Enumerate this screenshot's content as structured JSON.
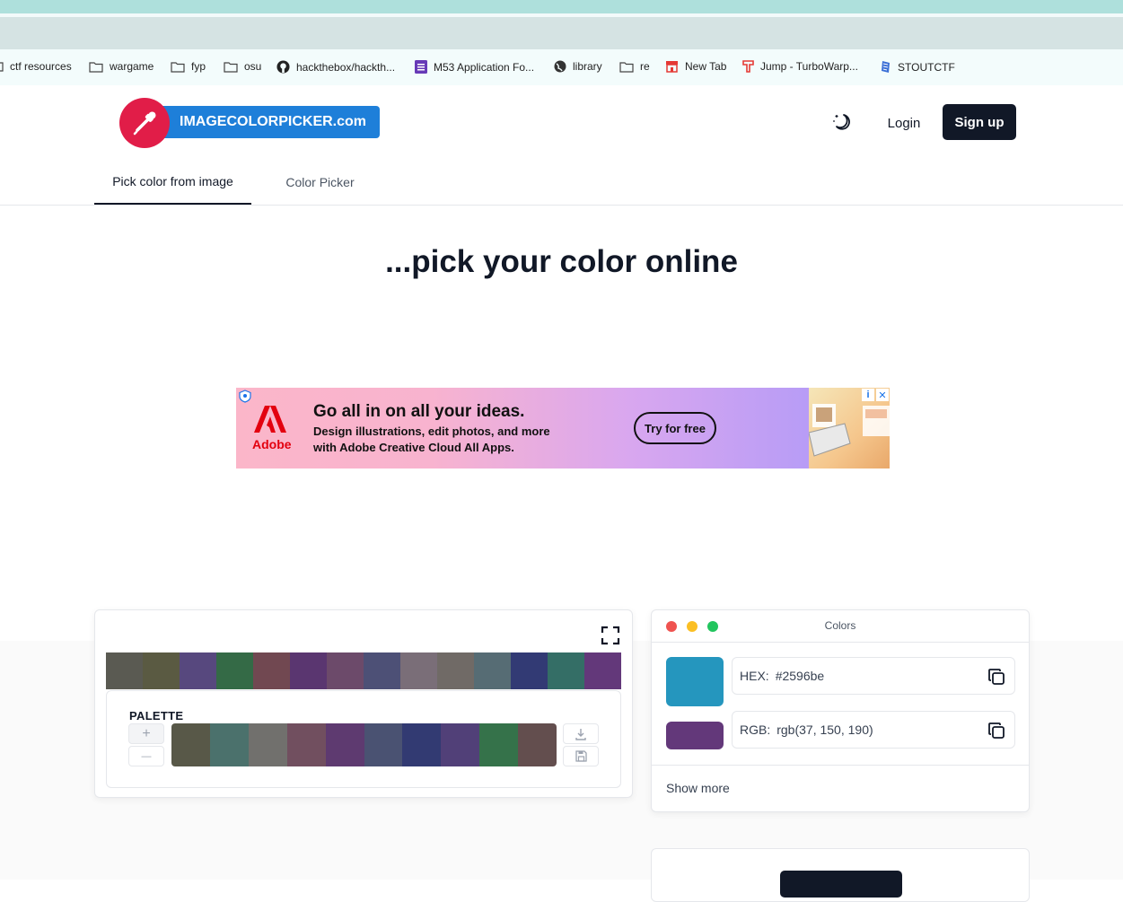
{
  "bookmarks": [
    {
      "label": "ctf resources",
      "icon": "folder-icon"
    },
    {
      "label": "wargame",
      "icon": "folder-icon"
    },
    {
      "label": "fyp",
      "icon": "folder-icon"
    },
    {
      "label": "osu",
      "icon": "folder-icon"
    },
    {
      "label": "hackthebox/hackth...",
      "icon": "github-icon"
    },
    {
      "label": "M53 Application Fo...",
      "icon": "forms-icon"
    },
    {
      "label": "library",
      "icon": "globe-icon"
    },
    {
      "label": "re",
      "icon": "folder-icon"
    },
    {
      "label": "New Tab",
      "icon": "store-icon"
    },
    {
      "label": "Jump - TurboWarp...",
      "icon": "turbowarp-icon"
    },
    {
      "label": "STOUTCTF",
      "icon": "flag-icon"
    }
  ],
  "header": {
    "logo_text": "IMAGECOLORPICKER.com",
    "login_label": "Login",
    "signup_label": "Sign up",
    "theme_icon": "moon-stars-icon"
  },
  "tabs": [
    {
      "label": "Pick color from image",
      "active": true
    },
    {
      "label": "Color Picker",
      "active": false
    }
  ],
  "headline": "...pick your color online",
  "ad": {
    "brand": "Adobe",
    "headline": "Go all in on all your ideas.",
    "line1": "Design illustrations, edit photos, and more",
    "line2": "with Adobe Creative Cloud All Apps.",
    "cta": "Try for free"
  },
  "image_strip_colors": [
    "#5a5a52",
    "#5a5a42",
    "#57487e",
    "#346a46",
    "#714851",
    "#5a3670",
    "#6c4a6a",
    "#4d5076",
    "#7a6e78",
    "#706a66",
    "#566c74",
    "#323a74",
    "#346e66",
    "#63387a"
  ],
  "palette": {
    "title": "PALETTE",
    "add_label": "+",
    "remove_label": "—",
    "colors": [
      "#585848",
      "#4b716c",
      "#71706d",
      "#714f5f",
      "#5e3a70",
      "#4a5272",
      "#323a72",
      "#514078",
      "#35724a",
      "#634e4e"
    ]
  },
  "colors_panel": {
    "title": "Colors",
    "primary_color": "#2596be",
    "secondary_color": "#63387a",
    "hex_label": "HEX:",
    "hex_value": "#2596be",
    "rgb_label": "RGB:",
    "rgb_value": "rgb(37, 150, 190)",
    "show_more": "Show more"
  }
}
